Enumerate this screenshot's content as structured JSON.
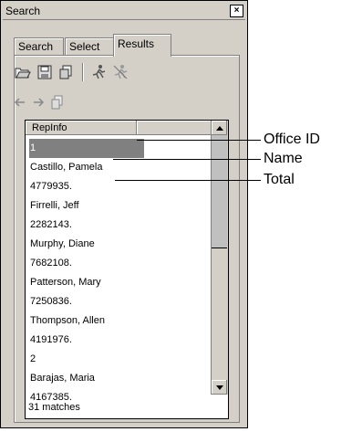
{
  "window": {
    "title": "Search",
    "close_glyph": "×"
  },
  "tabs": [
    {
      "label": "Search"
    },
    {
      "label": "Select"
    },
    {
      "label": "Results"
    }
  ],
  "toolbar": {
    "icons": [
      "open-folder-icon",
      "save-icon",
      "copy-icon",
      "run-icon",
      "run-disabled-icon"
    ]
  },
  "nav": {
    "icons": [
      "arrow-left-icon",
      "arrow-right-icon",
      "page-copy-icon"
    ]
  },
  "list": {
    "column_header": "RepInfo",
    "rows": [
      "1",
      "Castillo, Pamela",
      "4779935.",
      "Firrelli, Jeff",
      "2282143.",
      "Murphy, Diane",
      "7682108.",
      "Patterson, Mary",
      "7250836.",
      "Thompson, Allen",
      "4191976.",
      "2",
      "Barajas, Maria",
      "4167385."
    ],
    "selected_index": 0
  },
  "status": {
    "matches": "31 matches"
  },
  "callouts": {
    "office_id": "Office ID",
    "name": "Name",
    "total": "Total"
  }
}
